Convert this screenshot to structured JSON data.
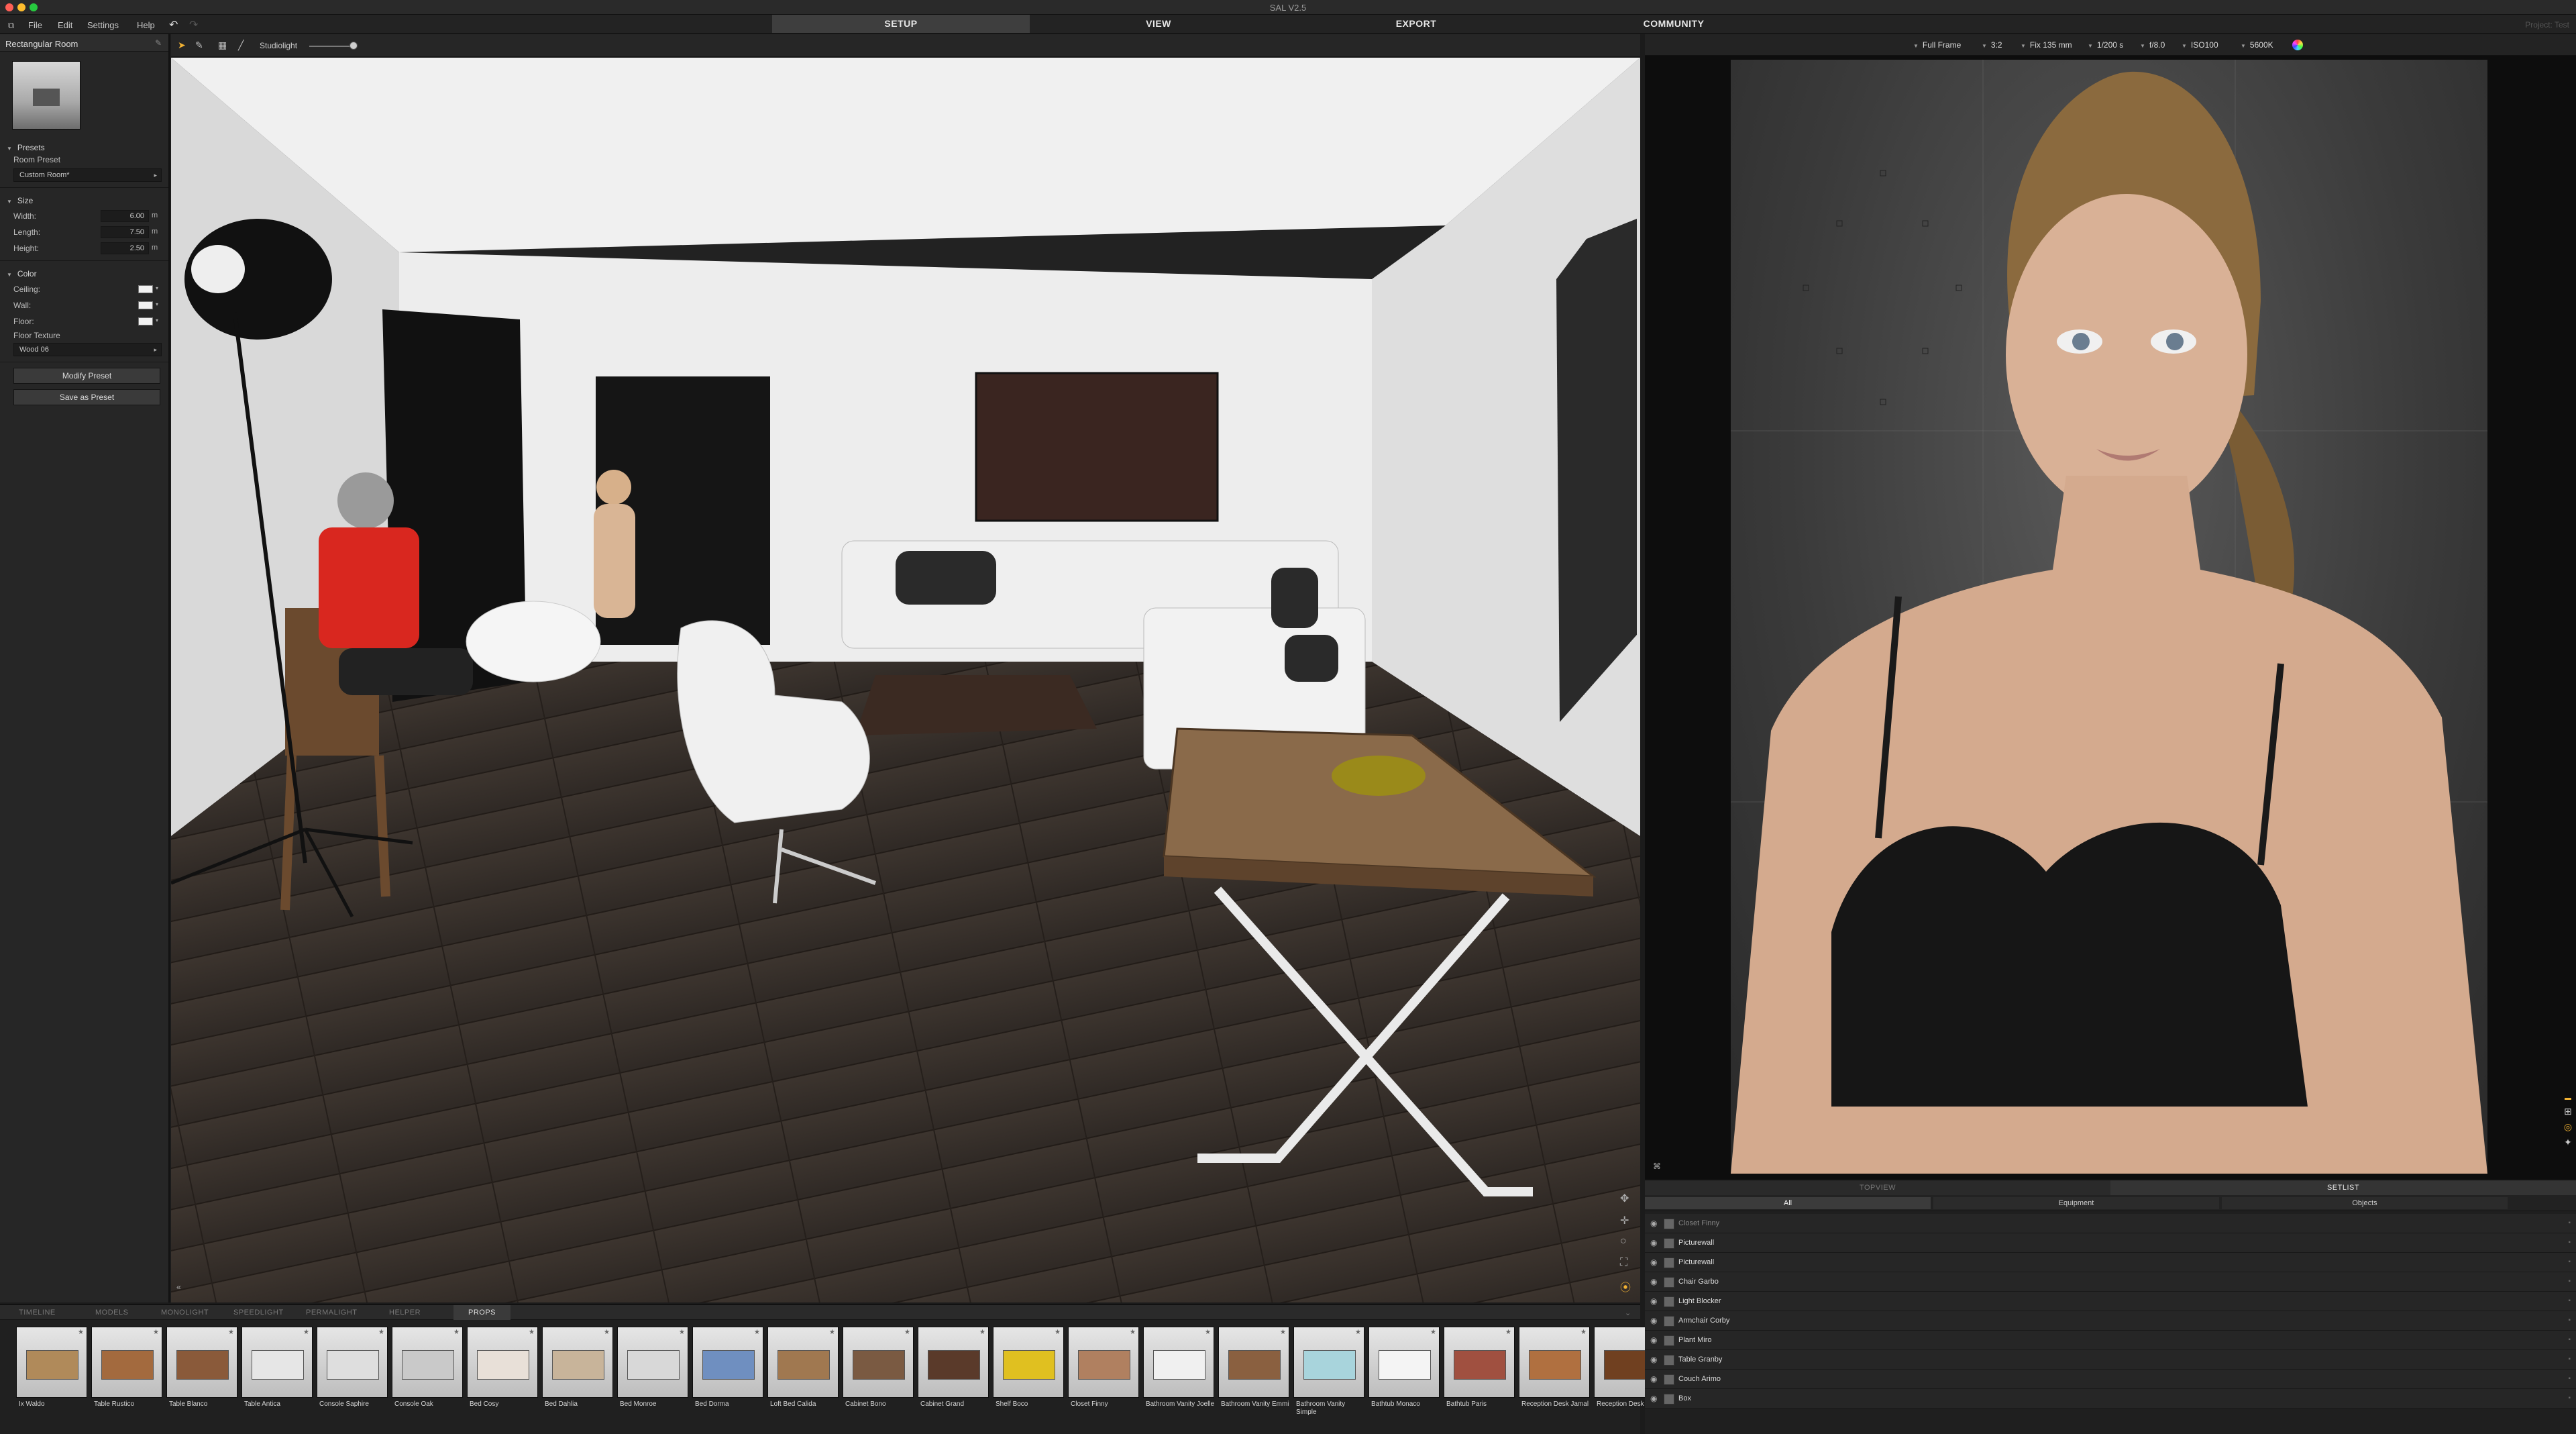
{
  "app": {
    "title": "SAL V2.5",
    "project": "Project: Test"
  },
  "menu": {
    "file": "File",
    "edit": "Edit",
    "settings": "Settings",
    "help": "Help"
  },
  "modes": {
    "setup": "SETUP",
    "view": "VIEW",
    "export": "EXPORT",
    "community": "COMMUNITY"
  },
  "left_panel": {
    "title": "Rectangular Room",
    "presets_section": "Presets",
    "room_preset_label": "Room Preset",
    "room_preset_value": "Custom Room*",
    "size_section": "Size",
    "width_label": "Width:",
    "width_value": "6.00",
    "width_unit": "m",
    "length_label": "Length:",
    "length_value": "7.50",
    "length_unit": "m",
    "height_label": "Height:",
    "height_value": "2.50",
    "height_unit": "m",
    "color_section": "Color",
    "ceiling_label": "Ceiling:",
    "wall_label": "Wall:",
    "floor_label": "Floor:",
    "floor_texture_label": "Floor Texture",
    "floor_texture_value": "Wood 06",
    "modify_preset": "Modify Preset",
    "save_as_preset": "Save as Preset"
  },
  "viewport": {
    "light_label": "Studiolight"
  },
  "camera": {
    "sensor": "Full Frame",
    "aspect": "3:2",
    "lens": "Fix 135 mm",
    "shutter": "1/200 s",
    "aperture": "f/8.0",
    "iso": "ISO100",
    "white_balance": "5600K"
  },
  "library": {
    "tabs": [
      "TIMELINE",
      "MODELS",
      "MONOLIGHT",
      "SPEEDLIGHT",
      "PERMALIGHT",
      "HELPER",
      "PROPS"
    ],
    "active_tab": "PROPS",
    "items": [
      "Ix Waldo",
      "Table Rustico",
      "Table Blanco",
      "Table Antica",
      "Console Saphire",
      "Console Oak",
      "Bed Cosy",
      "Bed Dahlia",
      "Bed Monroe",
      "Bed Dorma",
      "Loft Bed Calida",
      "Cabinet Bono",
      "Cabinet Grand",
      "Shelf Boco",
      "Closet Finny",
      "Bathroom Vanity Joelle",
      "Bathroom Vanity Emmi",
      "Bathroom Vanity Simple",
      "Bathtub Monaco",
      "Bathtub Paris",
      "Reception Desk Jamal",
      "Reception Desk"
    ]
  },
  "setlist": {
    "tab_topview": "TOPVIEW",
    "tab_setlist": "SETLIST",
    "filters": [
      "All",
      "Equipment",
      "Objects"
    ],
    "rows": [
      "Closet Finny",
      "Picturewall",
      "Picturewall",
      "Chair Garbo",
      "Light Blocker",
      "Armchair Corby",
      "Plant Miro",
      "Table Granby",
      "Couch Arimo",
      "Box"
    ]
  },
  "colors": {
    "accent": "#f2b233",
    "panel": "#262626",
    "floor_wood": "#4a3f37",
    "wall": "#e8e8e8"
  },
  "icons": {
    "undo": "undo-icon",
    "redo": "redo-icon",
    "select": "select-arrow-icon",
    "pen": "pen-icon",
    "grid": "grid-icon",
    "line": "line-tool-icon",
    "eye": "eye-icon",
    "lock": "lock-icon"
  }
}
